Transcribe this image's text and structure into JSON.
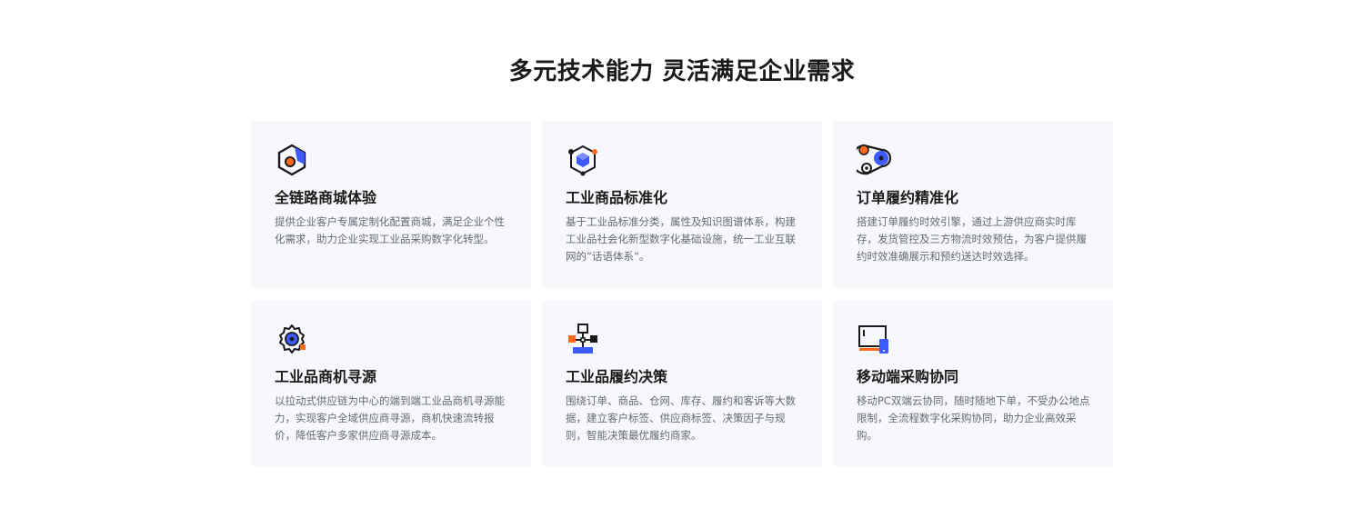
{
  "section": {
    "title": "多元技术能力 灵活满足企业需求"
  },
  "cards": [
    {
      "icon": "hexagon-nut-icon",
      "title": "全链路商城体验",
      "desc": "提供企业客户专属定制化配置商城，满足企业个性化需求，助力企业实现工业品采购数字化转型。"
    },
    {
      "icon": "cube-network-icon",
      "title": "工业商品标准化",
      "desc": "基于工业品标准分类，属性及知识图谱体系，构建工业品社会化新型数字化基础设施，统一工业互联网的”话语体系“。"
    },
    {
      "icon": "conveyor-belt-icon",
      "title": "订单履约精准化",
      "desc": "搭建订单履约时效引擎，通过上游供应商实时库存，发货管控及三方物流时效预估，为客户提供履约时效准确展示和预约送达时效选择。"
    },
    {
      "icon": "gear-icon",
      "title": "工业品商机寻源",
      "desc": "以拉动式供应链为中心的端到端工业品商机寻源能力，实现客户全域供应商寻源，商机快速流转报价，降低客户多家供应商寻源成本。"
    },
    {
      "icon": "flowchart-icon",
      "title": "工业品履约决策",
      "desc": "围绕订单、商品、仓网、库存、履约和客诉等大数据，建立客户标签、供应商标签、决策因子与规则，智能决策最优履约商家。"
    },
    {
      "icon": "monitor-phone-icon",
      "title": "移动端采购协同",
      "desc": "移动PC双端云协同，随时随地下单，不受办公地点限制，全流程数字化采购协同，助力企业高效采购。"
    }
  ],
  "colors": {
    "accent_blue": "#3d5afe",
    "accent_orange": "#ff6a1a",
    "card_bg": "#f7f8fc",
    "desc_text": "#666a73"
  }
}
